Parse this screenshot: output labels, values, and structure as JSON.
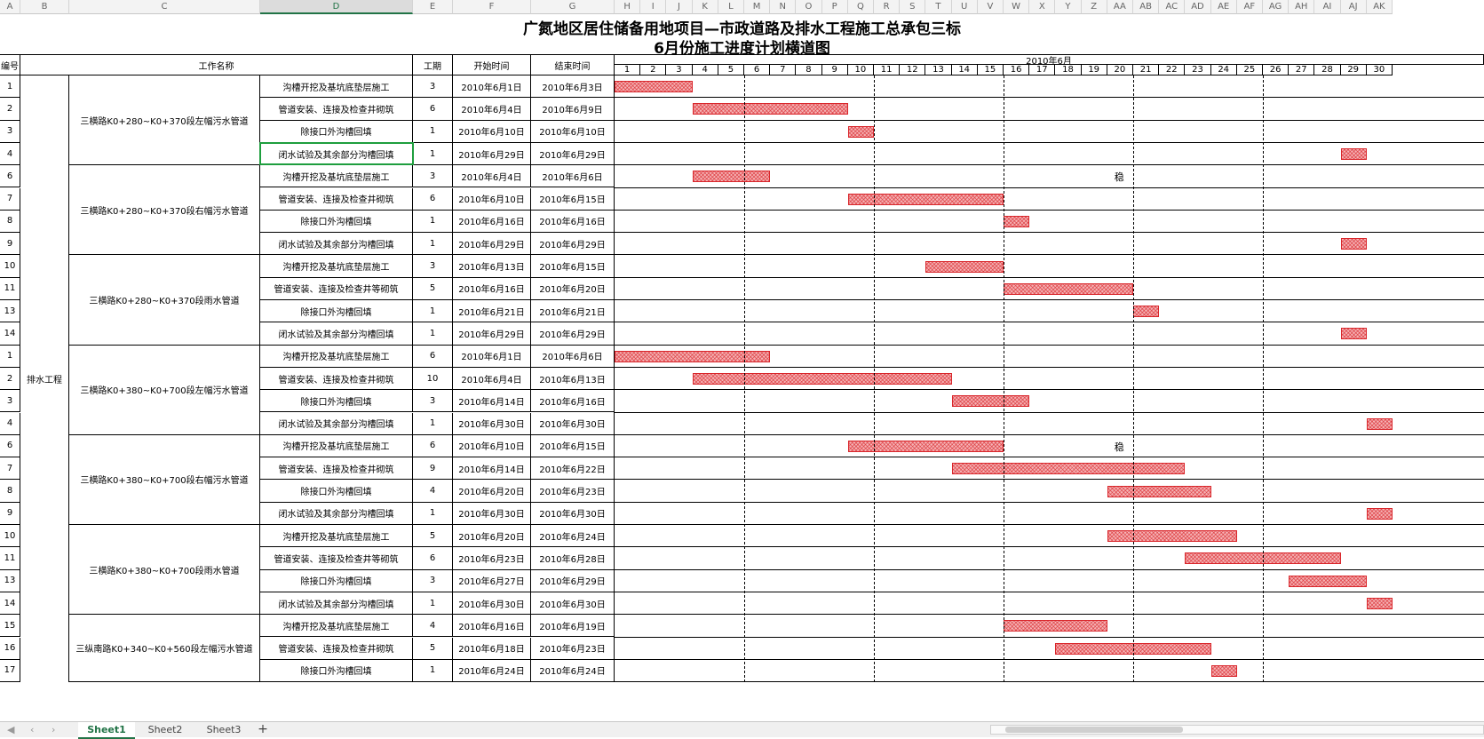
{
  "column_letters": [
    "A",
    "B",
    "C",
    "D",
    "E",
    "F",
    "G",
    "H",
    "I",
    "J",
    "K",
    "L",
    "M",
    "N",
    "O",
    "P",
    "Q",
    "R",
    "S",
    "T",
    "U",
    "V",
    "W",
    "X",
    "Y",
    "Z",
    "AA",
    "AB",
    "AC",
    "AD",
    "AE",
    "AF",
    "AG",
    "AH",
    "AI",
    "AJ",
    "AK"
  ],
  "selected_column": "D",
  "title_line1": "广氮地区居住储备用地项目—市政道路及排水工程施工总承包三标",
  "title_line2": "6月份施工进度计划横道图",
  "headers": {
    "num": "编号",
    "task_name": "工作名称",
    "duration": "工期",
    "start": "开始时间",
    "end": "结束时间",
    "month": "2010年6月"
  },
  "days": [
    "1",
    "2",
    "3",
    "4",
    "5",
    "6",
    "7",
    "8",
    "9",
    "10",
    "11",
    "12",
    "13",
    "14",
    "15",
    "16",
    "17",
    "18",
    "19",
    "20",
    "21",
    "22",
    "23",
    "24",
    "25",
    "26",
    "27",
    "28",
    "29",
    "30"
  ],
  "category": "排水工程",
  "groups": [
    {
      "name": "三横路K0+280~K0+370段左幅污水管道",
      "rows": 4
    },
    {
      "name": "三横路K0+280~K0+370段右幅污水管道",
      "rows": 4
    },
    {
      "name": "三横路K0+280~K0+370段雨水管道",
      "rows": 4
    },
    {
      "name": "三横路K0+380~K0+700段左幅污水管道",
      "rows": 4
    },
    {
      "name": "三横路K0+380~K0+700段右幅污水管道",
      "rows": 4
    },
    {
      "name": "三横路K0+380~K0+700段雨水管道",
      "rows": 4
    },
    {
      "name": "三纵南路K0+340~K0+560段左幅污水管道",
      "rows": 3
    }
  ],
  "tasks": [
    {
      "num": "1",
      "name": "沟槽开挖及基坑底垫层施工",
      "duration": "3",
      "start": "2010年6月1日",
      "end": "2010年6月3日",
      "s": 1,
      "e": 3
    },
    {
      "num": "2",
      "name": "管道安装、连接及检查井砌筑",
      "duration": "6",
      "start": "2010年6月4日",
      "end": "2010年6月9日",
      "s": 4,
      "e": 9
    },
    {
      "num": "3",
      "name": "除接口外沟槽回填",
      "duration": "1",
      "start": "2010年6月10日",
      "end": "2010年6月10日",
      "s": 10,
      "e": 10
    },
    {
      "num": "4",
      "name": "闭水试验及其余部分沟槽回填",
      "duration": "1",
      "start": "2010年6月29日",
      "end": "2010年6月29日",
      "s": 29,
      "e": 29
    },
    {
      "num": "6",
      "name": "沟槽开挖及基坑底垫层施工",
      "duration": "3",
      "start": "2010年6月4日",
      "end": "2010年6月6日",
      "s": 4,
      "e": 6
    },
    {
      "num": "7",
      "name": "管道安装、连接及检查井砌筑",
      "duration": "6",
      "start": "2010年6月10日",
      "end": "2010年6月15日",
      "s": 10,
      "e": 15
    },
    {
      "num": "8",
      "name": "除接口外沟槽回填",
      "duration": "1",
      "start": "2010年6月16日",
      "end": "2010年6月16日",
      "s": 16,
      "e": 16
    },
    {
      "num": "9",
      "name": "闭水试验及其余部分沟槽回填",
      "duration": "1",
      "start": "2010年6月29日",
      "end": "2010年6月29日",
      "s": 29,
      "e": 29
    },
    {
      "num": "10",
      "name": "沟槽开挖及基坑底垫层施工",
      "duration": "3",
      "start": "2010年6月13日",
      "end": "2010年6月15日",
      "s": 13,
      "e": 15
    },
    {
      "num": "11",
      "name": "管道安装、连接及检查井等砌筑",
      "duration": "5",
      "start": "2010年6月16日",
      "end": "2010年6月20日",
      "s": 16,
      "e": 20
    },
    {
      "num": "13",
      "name": "除接口外沟槽回填",
      "duration": "1",
      "start": "2010年6月21日",
      "end": "2010年6月21日",
      "s": 21,
      "e": 21
    },
    {
      "num": "14",
      "name": "闭水试验及其余部分沟槽回填",
      "duration": "1",
      "start": "2010年6月29日",
      "end": "2010年6月29日",
      "s": 29,
      "e": 29
    },
    {
      "num": "1",
      "name": "沟槽开挖及基坑底垫层施工",
      "duration": "6",
      "start": "2010年6月1日",
      "end": "2010年6月6日",
      "s": 1,
      "e": 6
    },
    {
      "num": "2",
      "name": "管道安装、连接及检查井砌筑",
      "duration": "10",
      "start": "2010年6月4日",
      "end": "2010年6月13日",
      "s": 4,
      "e": 13
    },
    {
      "num": "3",
      "name": "除接口外沟槽回填",
      "duration": "3",
      "start": "2010年6月14日",
      "end": "2010年6月16日",
      "s": 14,
      "e": 16
    },
    {
      "num": "4",
      "name": "闭水试验及其余部分沟槽回填",
      "duration": "1",
      "start": "2010年6月30日",
      "end": "2010年6月30日",
      "s": 30,
      "e": 30
    },
    {
      "num": "6",
      "name": "沟槽开挖及基坑底垫层施工",
      "duration": "6",
      "start": "2010年6月10日",
      "end": "2010年6月15日",
      "s": 10,
      "e": 15
    },
    {
      "num": "7",
      "name": "管道安装、连接及检查井砌筑",
      "duration": "9",
      "start": "2010年6月14日",
      "end": "2010年6月22日",
      "s": 14,
      "e": 22
    },
    {
      "num": "8",
      "name": "除接口外沟槽回填",
      "duration": "4",
      "start": "2010年6月20日",
      "end": "2010年6月23日",
      "s": 20,
      "e": 23
    },
    {
      "num": "9",
      "name": "闭水试验及其余部分沟槽回填",
      "duration": "1",
      "start": "2010年6月30日",
      "end": "2010年6月30日",
      "s": 30,
      "e": 30
    },
    {
      "num": "10",
      "name": "沟槽开挖及基坑底垫层施工",
      "duration": "5",
      "start": "2010年6月20日",
      "end": "2010年6月24日",
      "s": 20,
      "e": 24
    },
    {
      "num": "11",
      "name": "管道安装、连接及检查井等砌筑",
      "duration": "6",
      "start": "2010年6月23日",
      "end": "2010年6月28日",
      "s": 23,
      "e": 28
    },
    {
      "num": "13",
      "name": "除接口外沟槽回填",
      "duration": "3",
      "start": "2010年6月27日",
      "end": "2010年6月29日",
      "s": 27,
      "e": 29
    },
    {
      "num": "14",
      "name": "闭水试验及其余部分沟槽回填",
      "duration": "1",
      "start": "2010年6月30日",
      "end": "2010年6月30日",
      "s": 30,
      "e": 30
    },
    {
      "num": "15",
      "name": "沟槽开挖及基坑底垫层施工",
      "duration": "4",
      "start": "2010年6月16日",
      "end": "2010年6月19日",
      "s": 16,
      "e": 19
    },
    {
      "num": "16",
      "name": "管道安装、连接及检查井砌筑",
      "duration": "5",
      "start": "2010年6月18日",
      "end": "2010年6月23日",
      "s": 18,
      "e": 23
    },
    {
      "num": "17",
      "name": "除接口外沟槽回填",
      "duration": "1",
      "start": "2010年6月24日",
      "end": "2010年6月24日",
      "s": 24,
      "e": 24
    }
  ],
  "dashed_after_days": [
    5,
    10,
    15,
    20,
    25
  ],
  "stray_marks": [
    {
      "text": "稳",
      "task_index": 4,
      "day": 20
    },
    {
      "text": "稳",
      "task_index": 16,
      "day": 20
    }
  ],
  "sheet_tabs": [
    "Sheet1",
    "Sheet2",
    "Sheet3"
  ],
  "active_tab": "Sheet1",
  "add_sheet": "+",
  "bar_color": "#d9262b",
  "accent_color": "#217346"
}
